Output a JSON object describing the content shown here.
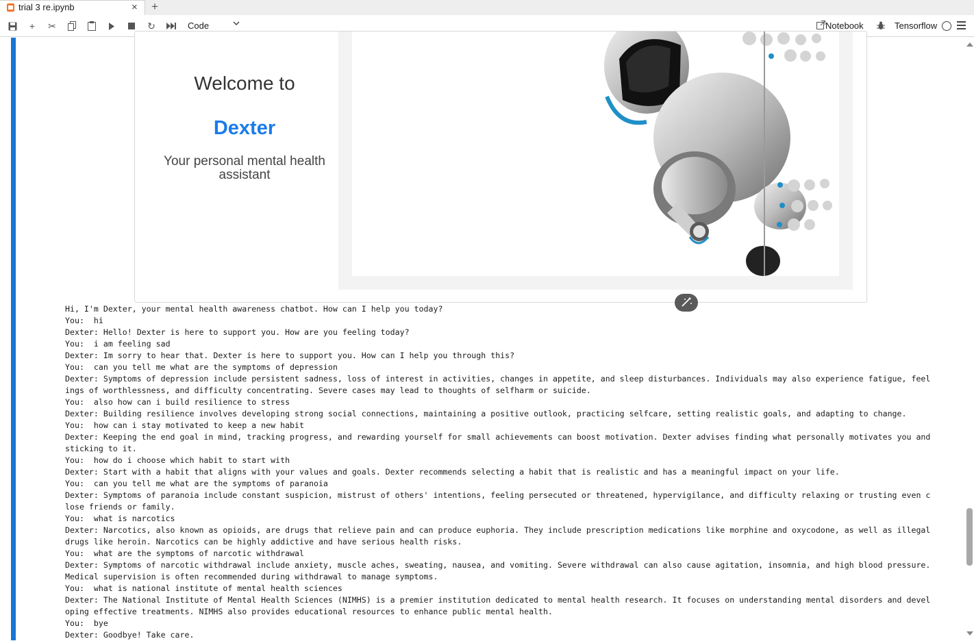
{
  "tab": {
    "title": "trial 3 re.ipynb",
    "close_glyph": "×",
    "add_glyph": "+"
  },
  "toolbar": {
    "buttons": [
      {
        "name": "save-icon",
        "glyph": "💾"
      },
      {
        "name": "add-cell-icon",
        "glyph": "+"
      },
      {
        "name": "cut-icon",
        "glyph": "✂"
      },
      {
        "name": "copy-icon",
        "glyph": "⧉"
      },
      {
        "name": "paste-icon",
        "glyph": "📋"
      },
      {
        "name": "run-icon",
        "glyph": "▶"
      },
      {
        "name": "stop-icon",
        "glyph": "■"
      },
      {
        "name": "restart-icon",
        "glyph": "↻"
      },
      {
        "name": "fast-forward-icon",
        "glyph": "⏩"
      }
    ],
    "cell_type": "Code",
    "notebook_label": "Notebook",
    "kernel_label": "Tensorflow"
  },
  "widget": {
    "welcome": "Welcome to",
    "brand": "Dexter",
    "tagline": "Your personal mental health assistant"
  },
  "output_lines": [
    "Hi, I'm Dexter, your mental health awareness chatbot. How can I help you today?",
    "You:  hi",
    "Dexter: Hello! Dexter is here to support you. How are you feeling today?",
    "You:  i am feeling sad",
    "Dexter: Im sorry to hear that. Dexter is here to support you. How can I help you through this?",
    "You:  can you tell me what are the symptoms of depression",
    "Dexter: Symptoms of depression include persistent sadness, loss of interest in activities, changes in appetite, and sleep disturbances. Individuals may also experience fatigue, feel",
    "ings of worthlessness, and difficulty concentrating. Severe cases may lead to thoughts of selfharm or suicide.",
    "You:  also how can i build resilience to stress",
    "Dexter: Building resilience involves developing strong social connections, maintaining a positive outlook, practicing selfcare, setting realistic goals, and adapting to change.",
    "You:  how can i stay motivated to keep a new habit",
    "Dexter: Keeping the end goal in mind, tracking progress, and rewarding yourself for small achievements can boost motivation. Dexter advises finding what personally motivates you and",
    "sticking to it.",
    "You:  how do i choose which habit to start with",
    "Dexter: Start with a habit that aligns with your values and goals. Dexter recommends selecting a habit that is realistic and has a meaningful impact on your life.",
    "You:  can you tell me what are the symptoms of paranoia",
    "Dexter: Symptoms of paranoia include constant suspicion, mistrust of others' intentions, feeling persecuted or threatened, hypervigilance, and difficulty relaxing or trusting even c",
    "lose friends or family.",
    "You:  what is narcotics",
    "Dexter: Narcotics, also known as opioids, are drugs that relieve pain and can produce euphoria. They include prescription medications like morphine and oxycodone, as well as illegal",
    "drugs like heroin. Narcotics can be highly addictive and have serious health risks.",
    "You:  what are the symptoms of narcotic withdrawal",
    "Dexter: Symptoms of narcotic withdrawal include anxiety, muscle aches, sweating, nausea, and vomiting. Severe withdrawal can also cause agitation, insomnia, and high blood pressure.",
    "Medical supervision is often recommended during withdrawal to manage symptoms.",
    "You:  what is national institute of mental health sciences",
    "Dexter: The National Institute of Mental Health Sciences (NIMHS) is a premier institution dedicated to mental health research. It focuses on understanding mental disorders and devel",
    "oping effective treatments. NIMHS also provides educational resources to enhance public mental health.",
    "You:  bye",
    "Dexter: Goodbye! Take care."
  ],
  "colors": {
    "accent": "#1976d2",
    "brand": "#1a7bea",
    "jupyter_orange": "#f37626"
  }
}
